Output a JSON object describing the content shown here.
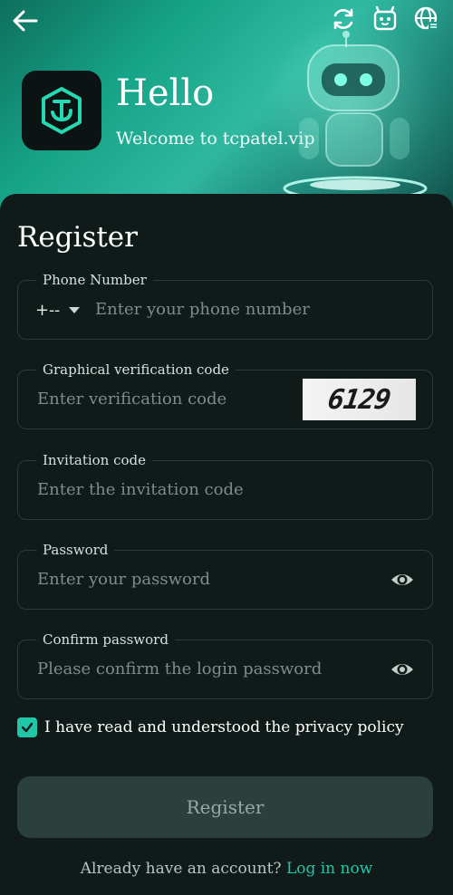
{
  "header": {
    "back_icon": "arrow-left-icon",
    "icons": [
      "refresh-icon",
      "customer-service-icon",
      "language-globe-icon"
    ]
  },
  "hero": {
    "title": "Hello",
    "subtitle": "Welcome to tcpatel.vip"
  },
  "form": {
    "title": "Register",
    "phone": {
      "label": "Phone Number",
      "country_code": "+--",
      "placeholder": "Enter your phone number"
    },
    "verification": {
      "label": "Graphical verification code",
      "placeholder": "Enter verification code",
      "captcha": "6129"
    },
    "invitation": {
      "label": "Invitation code",
      "placeholder": "Enter the invitation code"
    },
    "password": {
      "label": "Password",
      "placeholder": "Enter your password"
    },
    "confirm_password": {
      "label": "Confirm password",
      "placeholder": "Please confirm the login password"
    },
    "policy": {
      "checked": true,
      "text": "I have read and understood the privacy policy"
    },
    "submit_label": "Register",
    "login_prompt": "Already have an account?",
    "login_link": "Log in now"
  },
  "colors": {
    "accent": "#1fc7a6",
    "background": "#0f1a19",
    "button_bg": "#2b3f3b"
  }
}
